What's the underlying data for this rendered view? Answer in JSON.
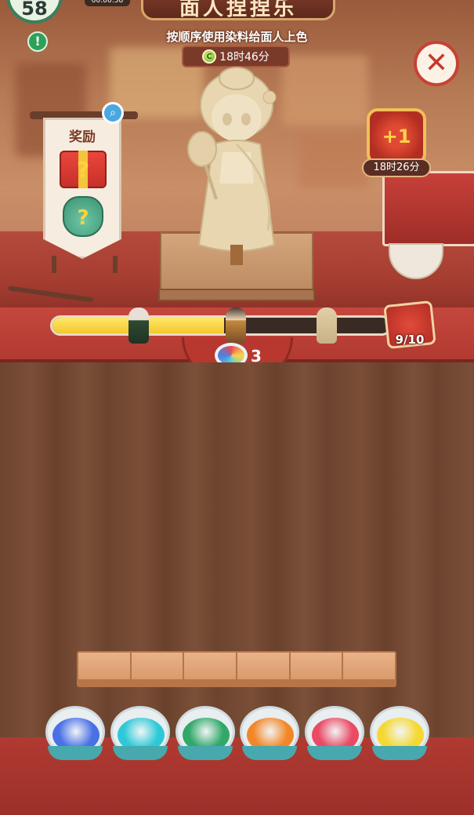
{
  "header": {
    "title": "面人捏捏乐",
    "subtitle": "按顺序使用染料给面人上色",
    "event_timer": "18时46分",
    "level": "58",
    "small_clock": "00:00:58"
  },
  "reward_panel": {
    "title": "奖励"
  },
  "chest": {
    "label": "+1",
    "timer": "18时26分"
  },
  "progress": {
    "fraction": 0.51,
    "count_text": "9/10"
  },
  "dye": {
    "count": "3"
  },
  "tray": {
    "slots": 6
  },
  "paints": [
    {
      "name": "blue",
      "color": "#4a70e6"
    },
    {
      "name": "cyan",
      "color": "#2ec9d8"
    },
    {
      "name": "green",
      "color": "#31a86a"
    },
    {
      "name": "orange",
      "color": "#f28728"
    },
    {
      "name": "pink",
      "color": "#e94a64"
    },
    {
      "name": "yellow",
      "color": "#f5d832"
    }
  ],
  "icons": {
    "close": "close-icon",
    "search": "search-icon",
    "alert": "alert-icon",
    "coin": "coin-icon"
  }
}
